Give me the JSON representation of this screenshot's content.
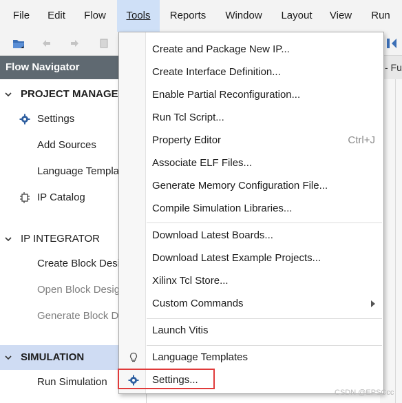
{
  "menubar": {
    "items": [
      {
        "label": "File"
      },
      {
        "label": "Edit"
      },
      {
        "label": "Flow"
      },
      {
        "label": "Tools"
      },
      {
        "label": "Reports"
      },
      {
        "label": "Window"
      },
      {
        "label": "Layout"
      },
      {
        "label": "View"
      },
      {
        "label": "Run"
      }
    ]
  },
  "toolbar": {
    "icons": [
      "open-project-icon",
      "undo-icon",
      "redo-icon",
      "copy-icon",
      "layout-icon"
    ]
  },
  "flow_navigator": {
    "title": "Flow Navigator",
    "project_manager": {
      "label": "PROJECT MANAGE",
      "items": [
        "Settings",
        "Add Sources",
        "Language Templat",
        "IP Catalog"
      ]
    },
    "ip_integrator": {
      "label": "IP INTEGRATOR",
      "items": [
        "Create Block Desi",
        "Open Block Desig",
        "Generate Block De"
      ]
    },
    "simulation": {
      "label": "SIMULATION",
      "items": [
        "Run Simulation"
      ]
    }
  },
  "right_tab": {
    "label": "- Fu"
  },
  "tools_menu": {
    "items": [
      {
        "label": "Create and Package New IP..."
      },
      {
        "label": "Create Interface Definition..."
      },
      {
        "label": "Enable Partial Reconfiguration..."
      },
      {
        "label": "Run Tcl Script..."
      },
      {
        "label": "Property Editor",
        "shortcut": "Ctrl+J"
      },
      {
        "label": "Associate ELF Files..."
      },
      {
        "label": "Generate Memory Configuration File..."
      },
      {
        "label": "Compile Simulation Libraries..."
      },
      {
        "label": "Download Latest Boards..."
      },
      {
        "label": "Download Latest Example Projects..."
      },
      {
        "label": "Xilinx Tcl Store..."
      },
      {
        "label": "Custom Commands"
      },
      {
        "label": "Launch Vitis"
      },
      {
        "label": "Language Templates"
      },
      {
        "label": "Settings..."
      }
    ]
  },
  "watermark": "CSDN @EPSCcc",
  "colors": {
    "active_menu": "#cfe0f7",
    "nav_header": "#5f6971",
    "selected_row": "#cfdcf3",
    "highlight_box": "#e03a3a"
  }
}
